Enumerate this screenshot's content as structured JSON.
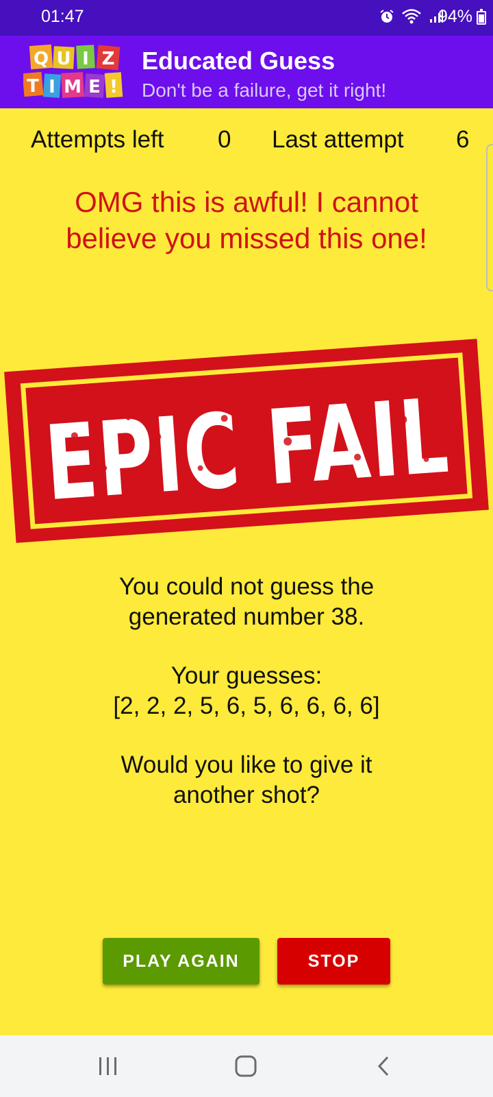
{
  "status_bar": {
    "time": "01:47",
    "battery": "94%",
    "icons": [
      "alarm-icon",
      "wifi-icon",
      "signal-icon",
      "battery-icon"
    ]
  },
  "app_bar": {
    "logo_text": "QUIZ TIME!",
    "title": "Educated Guess",
    "subtitle": "Don't be a failure, get it right!"
  },
  "stats": {
    "attempts_left_label": "Attempts left",
    "attempts_left_value": "0",
    "last_attempt_label": "Last attempt",
    "last_attempt_value": "6"
  },
  "message": "OMG this is awful! I cannot believe you missed this one!",
  "stamp": {
    "text": "EPIC FAIL"
  },
  "result": {
    "line1": "You could not guess the",
    "line2": "generated number 38.",
    "guesses_label": "Your guesses:",
    "guesses": "[2, 2, 2, 5, 6, 5, 6, 6, 6, 6]",
    "prompt1": "Would you like to give it",
    "prompt2": "another shot?"
  },
  "buttons": {
    "play_again": "PLAY AGAIN",
    "stop": "STOP"
  },
  "nav_bar": {
    "icons": [
      "recent-apps-icon",
      "home-icon",
      "back-icon"
    ]
  },
  "colors": {
    "status_bar": "#4610BE",
    "app_bar": "#6D0EEC",
    "background": "#FDEA3A",
    "message": "#CF1217",
    "stamp_red": "#D2111A",
    "play_button": "#5B9A00",
    "stop_button": "#D60000"
  }
}
